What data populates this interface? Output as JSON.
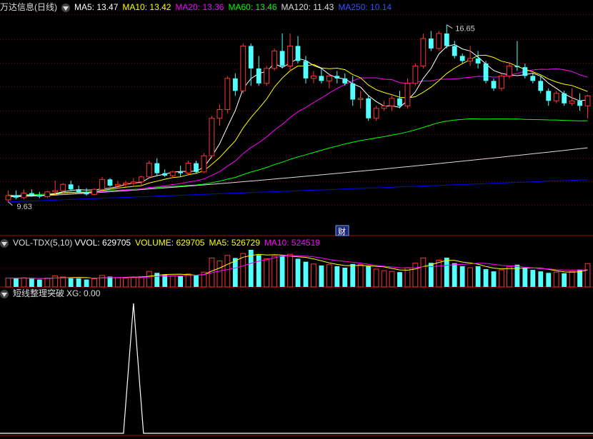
{
  "main_header": {
    "stock_name": "万达信息(日线)",
    "ma5": "MA5: 13.47",
    "ma10": "MA10: 13.42",
    "ma20": "MA20: 13.36",
    "ma60": "MA60: 13.46",
    "ma120": "MA120: 11.43",
    "ma250": "MA250: 10.14"
  },
  "vol_header": {
    "title": "VOL-TDX(5,10)",
    "vvol": "VVOL: 629705",
    "volume": "VOLUME: 629705",
    "ma5": "MA5: 526729",
    "ma10": "MA10: 524519"
  },
  "ind_header": {
    "title": "短线整理突破",
    "xg": "XG: 0.00"
  },
  "annotations": {
    "high_label": "16.65",
    "low_label": "9.63",
    "event_marker": "财"
  },
  "colors": {
    "up": "#ff3333",
    "down": "#54ffff",
    "ma5": "#ffffff",
    "ma10": "#ffff00",
    "ma20": "#ff00ff",
    "ma60": "#00ff00",
    "ma120": "#dddddd",
    "ma250": "#0000ff",
    "grid": "#800000"
  },
  "chart_data": {
    "type": "candlestick",
    "candles": [
      [
        9.63,
        10.0,
        9.55,
        9.8
      ],
      [
        9.8,
        10.0,
        9.65,
        9.72
      ],
      [
        9.72,
        10.05,
        9.65,
        9.9
      ],
      [
        9.9,
        10.05,
        9.75,
        9.82
      ],
      [
        9.82,
        9.95,
        9.7,
        9.76
      ],
      [
        9.76,
        10.0,
        9.7,
        9.95
      ],
      [
        9.95,
        10.4,
        9.85,
        10.0
      ],
      [
        10.0,
        10.3,
        9.9,
        10.25
      ],
      [
        10.25,
        10.4,
        10.0,
        10.05
      ],
      [
        10.05,
        10.2,
        9.9,
        9.95
      ],
      [
        9.95,
        10.1,
        9.8,
        9.85
      ],
      [
        9.85,
        10.1,
        9.8,
        10.05
      ],
      [
        10.05,
        10.55,
        10.0,
        10.45
      ],
      [
        10.45,
        10.5,
        10.15,
        10.2
      ],
      [
        10.2,
        10.4,
        10.1,
        10.25
      ],
      [
        10.25,
        10.4,
        10.15,
        10.3
      ],
      [
        10.3,
        10.5,
        10.15,
        10.35
      ],
      [
        10.35,
        10.6,
        10.2,
        10.55
      ],
      [
        10.55,
        11.2,
        10.5,
        11.1
      ],
      [
        11.1,
        11.3,
        10.6,
        10.7
      ],
      [
        10.7,
        10.85,
        10.55,
        10.6
      ],
      [
        10.6,
        10.8,
        10.5,
        10.75
      ],
      [
        10.75,
        11.0,
        10.55,
        10.7
      ],
      [
        10.7,
        11.2,
        10.6,
        11.1
      ],
      [
        11.1,
        11.2,
        10.7,
        10.75
      ],
      [
        10.75,
        11.5,
        10.7,
        11.4
      ],
      [
        11.4,
        13.0,
        11.3,
        12.9
      ],
      [
        12.9,
        13.45,
        12.6,
        13.25
      ],
      [
        13.25,
        14.6,
        13.1,
        14.5
      ],
      [
        14.5,
        14.7,
        13.8,
        14.0
      ],
      [
        14.0,
        15.9,
        13.9,
        15.8
      ],
      [
        15.8,
        15.9,
        14.2,
        14.9
      ],
      [
        14.9,
        15.4,
        14.2,
        14.3
      ],
      [
        14.3,
        15.0,
        14.2,
        14.9
      ],
      [
        14.9,
        15.7,
        14.8,
        15.6
      ],
      [
        15.6,
        16.3,
        14.9,
        15.0
      ],
      [
        15.0,
        16.3,
        14.8,
        15.8
      ],
      [
        15.8,
        16.2,
        15.1,
        15.2
      ],
      [
        15.2,
        15.4,
        14.3,
        14.5
      ],
      [
        14.5,
        14.8,
        14.3,
        14.6
      ],
      [
        14.6,
        14.9,
        14.3,
        14.4
      ],
      [
        14.4,
        14.7,
        14.1,
        14.6
      ],
      [
        14.6,
        14.8,
        14.3,
        14.5
      ],
      [
        14.5,
        14.7,
        14.2,
        14.3
      ],
      [
        14.3,
        14.6,
        13.4,
        13.65
      ],
      [
        13.65,
        14.0,
        13.3,
        13.7
      ],
      [
        13.7,
        13.8,
        12.8,
        12.9
      ],
      [
        12.9,
        13.4,
        12.8,
        13.3
      ],
      [
        13.3,
        13.6,
        13.2,
        13.4
      ],
      [
        13.4,
        13.8,
        13.2,
        13.7
      ],
      [
        13.7,
        14.0,
        13.3,
        13.4
      ],
      [
        13.4,
        14.5,
        13.3,
        14.3
      ],
      [
        14.3,
        15.1,
        14.2,
        15.0
      ],
      [
        15.0,
        16.3,
        14.9,
        16.1
      ],
      [
        16.1,
        16.4,
        15.6,
        15.7
      ],
      [
        15.7,
        16.4,
        15.6,
        16.3
      ],
      [
        16.3,
        16.65,
        15.7,
        15.8
      ],
      [
        15.8,
        16.0,
        15.3,
        15.4
      ],
      [
        15.4,
        15.5,
        15.1,
        15.2
      ],
      [
        15.2,
        15.8,
        15.0,
        15.3
      ],
      [
        15.3,
        15.6,
        14.9,
        15.1
      ],
      [
        15.1,
        15.2,
        14.3,
        14.4
      ],
      [
        14.4,
        14.5,
        14.0,
        14.1
      ],
      [
        14.1,
        14.7,
        14.0,
        14.6
      ],
      [
        14.6,
        15.1,
        14.5,
        15.0
      ],
      [
        15.0,
        16.0,
        14.8,
        14.95
      ],
      [
        14.95,
        15.1,
        14.5,
        14.6
      ],
      [
        14.6,
        14.7,
        14.3,
        14.4
      ],
      [
        14.4,
        14.6,
        13.9,
        14.0
      ],
      [
        14.0,
        14.1,
        13.4,
        13.6
      ],
      [
        13.6,
        14.0,
        13.5,
        13.9
      ],
      [
        13.9,
        14.0,
        13.4,
        13.5
      ],
      [
        13.5,
        14.1,
        13.4,
        13.6
      ],
      [
        13.6,
        13.9,
        13.2,
        13.4
      ],
      [
        13.4,
        13.85,
        12.9,
        13.8
      ]
    ],
    "volume": [
      240000,
      230000,
      250000,
      220000,
      200000,
      240000,
      300000,
      270000,
      260000,
      230000,
      200000,
      220000,
      310000,
      280000,
      250000,
      240000,
      260000,
      280000,
      420000,
      380000,
      330000,
      300000,
      290000,
      350000,
      320000,
      400000,
      780000,
      700000,
      850000,
      780000,
      900000,
      1000000,
      860000,
      760000,
      830000,
      840000,
      880000,
      760000,
      680000,
      620000,
      580000,
      600000,
      560000,
      520000,
      620000,
      600000,
      560000,
      480000,
      440000,
      420000,
      400000,
      520000,
      640000,
      780000,
      650000,
      720000,
      790000,
      640000,
      560000,
      520000,
      560000,
      480000,
      420000,
      460000,
      540000,
      600000,
      520000,
      460000,
      420000,
      380000,
      400000,
      370000,
      420000,
      470000,
      629705
    ],
    "xg_signal_index": 16,
    "price_range": [
      9.4,
      16.9
    ],
    "high": 16.65,
    "low": 9.63
  }
}
